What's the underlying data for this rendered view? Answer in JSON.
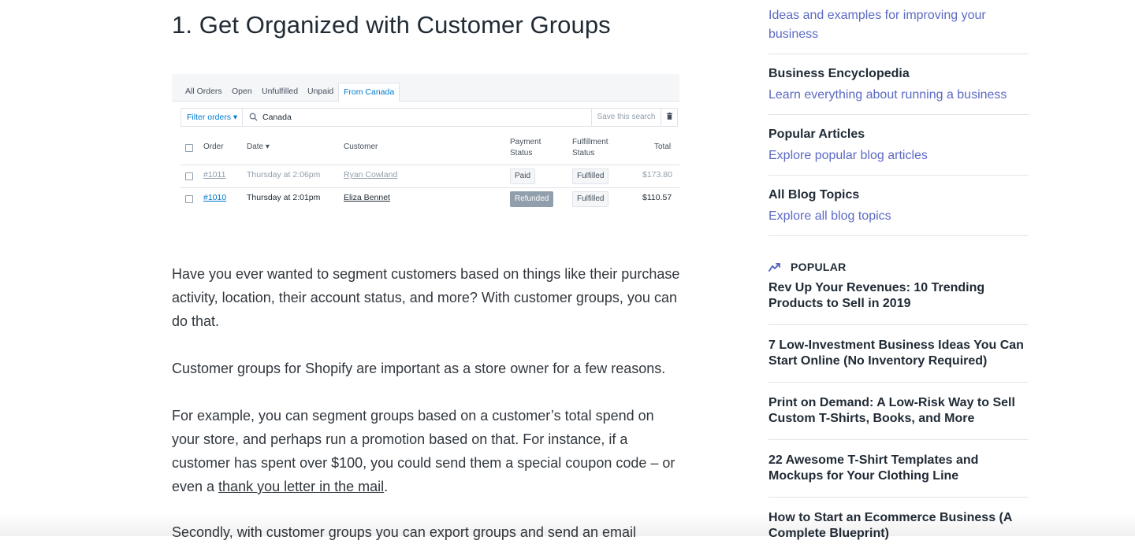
{
  "article": {
    "heading": "1. Get Organized with Customer Groups",
    "paragraphs": {
      "p1": "Have you ever wanted to segment customers based on things like their purchase activity, location, their account status, and more? With customer groups, you can do that.",
      "p2": "Customer groups for Shopify are important as a store owner for a few reasons.",
      "p3_before": "For example, you can segment groups based on a customer’s total spend on your store, and perhaps run a promotion based on that. For instance, if a customer has spent over $100, you could send them a special coupon code – or even a ",
      "p3_link": "thank you letter in the mail",
      "p3_after": ".",
      "p4": "Secondly, with customer groups you can export groups and send an email"
    }
  },
  "screenshot": {
    "tabs": [
      "All Orders",
      "Open",
      "Unfulfilled",
      "Unpaid",
      "From Canada"
    ],
    "active_tab": "From Canada",
    "filter_label": "Filter orders ▾",
    "search_value": "Canada",
    "save_label": "Save this search",
    "columns": {
      "order": "Order",
      "date": "Date ▾",
      "customer": "Customer",
      "payment_1": "Payment",
      "payment_2": "Status",
      "fulfillment_1": "Fulfillment",
      "fulfillment_2": "Status",
      "total": "Total"
    },
    "rows": [
      {
        "order": "#1011",
        "date": "Thursday at 2:06pm",
        "customer": "Ryan Cowland",
        "payment": "Paid",
        "fulfillment": "Fulfilled",
        "total": "$173.80"
      },
      {
        "order": "#1010",
        "date": "Thursday at 2:01pm",
        "customer": "Eliza Bennet",
        "payment": "Refunded",
        "fulfillment": "Fulfilled",
        "total": "$110.57"
      }
    ]
  },
  "sidebar": {
    "top_desc": "Ideas and examples for improving your business",
    "resources": [
      {
        "title": "Business Encyclopedia",
        "desc": "Learn everything about running a business"
      },
      {
        "title": "Popular Articles",
        "desc": "Explore popular blog articles"
      },
      {
        "title": "All Blog Topics",
        "desc": "Explore all blog topics"
      }
    ],
    "popular_label": "POPULAR",
    "popular_icon": "trending-icon",
    "popular_items": [
      "Rev Up Your Revenues: 10 Trending Products to Sell in 2019",
      "7 Low-Investment Business Ideas You Can Start Online (No Inventory Required)",
      "Print on Demand: A Low-Risk Way to Sell Custom T-Shirts, Books, and More",
      "22 Awesome T-Shirt Templates and Mockups for Your Clothing Line",
      "How to Start an Ecommerce Business (A Complete Blueprint)"
    ]
  },
  "colors": {
    "link_purple": "#5c6ac4",
    "text_dark": "#212b36",
    "body_text": "#31373d",
    "shopify_blue": "#007ace"
  }
}
